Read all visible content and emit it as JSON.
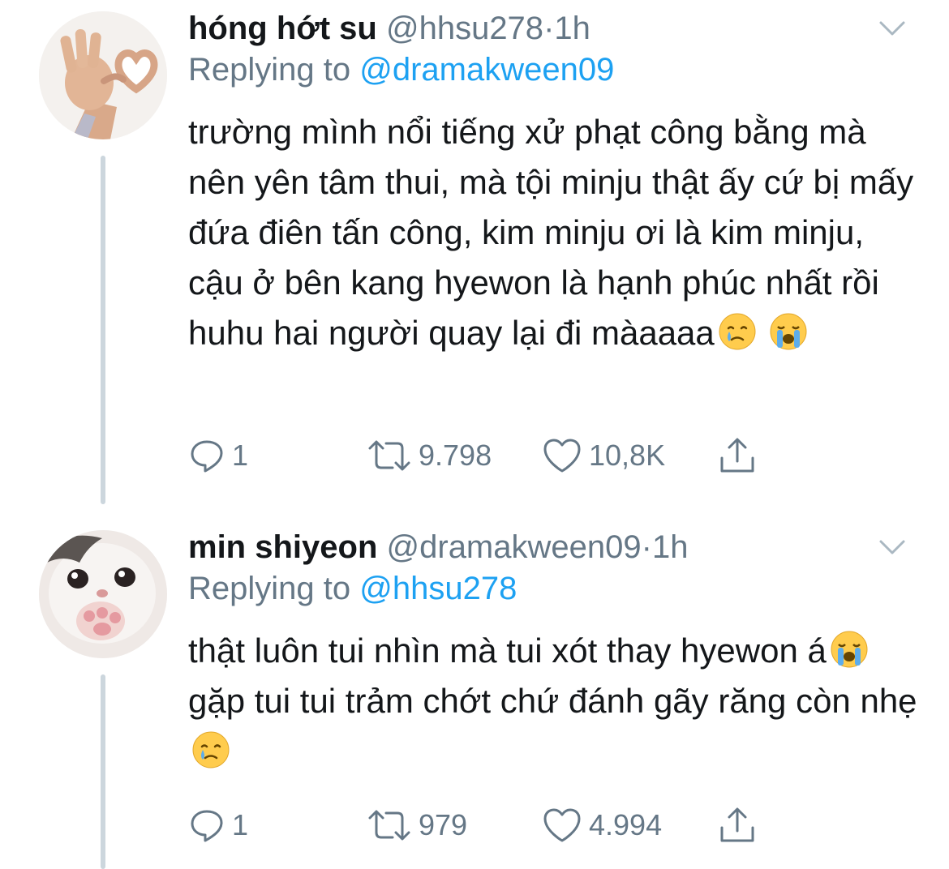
{
  "tweets": [
    {
      "display_name": "hóng hớt su",
      "handle": "@hhsu278",
      "separator": "·",
      "time": "1h",
      "replying_prefix": "Replying to",
      "replying_to": "@dramakween09",
      "text": "trường mình nổi tiếng xử phạt công bằng mà nên yên tâm thui, mà tội minju thật ấy cứ bị mấy đứa điên tấn công, kim minju ơi là kim minju, cậu ở bên kang hyewon là hạnh phúc nhất rồi huhu hai người quay lại đi màaaaa",
      "text_emojis": [
        "crying-face",
        "loudly-crying-face"
      ],
      "avatar": "ok-hand-heart-avatar",
      "replies": "1",
      "retweets": "9.798",
      "likes": "10,8K"
    },
    {
      "display_name": "min shiyeon",
      "handle": "@dramakween09",
      "separator": "·",
      "time": "1h",
      "replying_prefix": "Replying to",
      "replying_to": "@hhsu278",
      "text_part1": "thật luôn tui nhìn mà tui xót thay hyewon á",
      "text_part2": " gặp tui tui trảm chớt chứ đánh gãy răng còn nhẹ",
      "text_emojis": [
        "loudly-crying-face",
        "crying-face"
      ],
      "avatar": "crying-cat-avatar",
      "replies": "1",
      "retweets": "979",
      "likes": "4.994"
    }
  ],
  "icons": {
    "reply": "reply-icon",
    "retweet": "retweet-icon",
    "like": "heart-icon",
    "share": "share-icon",
    "more": "chevron-down-icon"
  },
  "colors": {
    "text": "#14171a",
    "muted": "#657786",
    "link": "#1da1f2",
    "thread_line": "#ccd6dd"
  }
}
